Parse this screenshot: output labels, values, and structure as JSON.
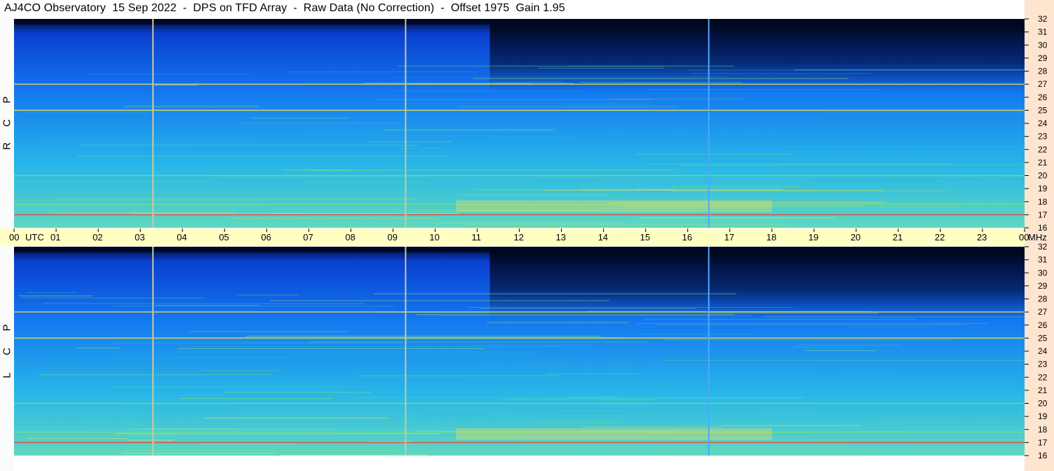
{
  "title": "AJ4CO Observatory  15 Sep 2022  -  DPS on TFD Array  -  Raw Data (No Correction)  -  Offset 1975  Gain 1.95",
  "chart_data": [
    {
      "type": "heatmap",
      "panel": "RCP",
      "panel_letters": [
        "R",
        "C",
        "P"
      ],
      "x_ticks": [
        "00",
        "01",
        "02",
        "03",
        "04",
        "05",
        "06",
        "07",
        "08",
        "09",
        "10",
        "11",
        "12",
        "13",
        "14",
        "15",
        "16",
        "17",
        "18",
        "19",
        "20",
        "21",
        "22",
        "23",
        "00"
      ],
      "x_unit": "UTC",
      "xlim": [
        0,
        24
      ],
      "y_ticks": [
        16,
        17,
        18,
        19,
        20,
        21,
        22,
        23,
        24,
        25,
        26,
        27,
        28,
        29,
        30,
        31,
        32
      ],
      "y_unit": "MHz",
      "ylim": [
        16,
        32
      ],
      "vertical_markers_utc": [
        3.3,
        9.3,
        16.5
      ],
      "strong_freq_lines_mhz": [
        17.0,
        17.8,
        20.0,
        25.0,
        27.0
      ]
    },
    {
      "type": "heatmap",
      "panel": "LCP",
      "panel_letters": [
        "L",
        "C",
        "P"
      ],
      "x_ticks": [
        "00",
        "01",
        "02",
        "03",
        "04",
        "05",
        "06",
        "07",
        "08",
        "09",
        "10",
        "11",
        "12",
        "13",
        "14",
        "15",
        "16",
        "17",
        "18",
        "19",
        "20",
        "21",
        "22",
        "23",
        "00"
      ],
      "x_unit": "UTC",
      "xlim": [
        0,
        24
      ],
      "y_ticks": [
        16,
        17,
        18,
        19,
        20,
        21,
        22,
        23,
        24,
        25,
        26,
        27,
        28,
        29,
        30,
        31,
        32
      ],
      "y_unit": "MHz",
      "ylim": [
        16,
        32
      ],
      "vertical_markers_utc": [
        3.3,
        9.3,
        16.5
      ],
      "strong_freq_lines_mhz": [
        17.0,
        17.8,
        20.0,
        25.0,
        27.0
      ]
    }
  ],
  "colors": {
    "background_dark": "#000822",
    "deep_blue": "#0a3fd0",
    "mid_blue": "#1478f0",
    "cyan": "#27b6e8",
    "green": "#7fe07a",
    "yellow": "#ffe24a",
    "red": "#ff3030",
    "time_band": "#ffffc4",
    "right_strip": "#fde5cf",
    "marker": "#c9c9a0"
  }
}
